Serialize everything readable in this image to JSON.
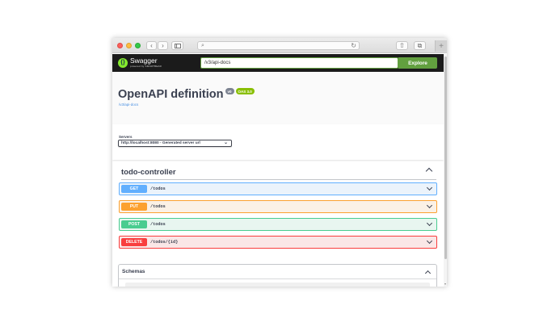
{
  "browser": {
    "address": "",
    "new_tab": "+"
  },
  "swagger": {
    "logo_name": "Swagger",
    "logo_sub": "powered by SMARTBEAR",
    "spec_url": "/v3/api-docs",
    "explore_label": "Explore"
  },
  "info": {
    "title": "OpenAPI definition",
    "version_badge": "v0",
    "oas_badge": "OAS 3.0",
    "spec_link": "/v3/api-docs"
  },
  "servers": {
    "label": "Servers",
    "selected": "http://localhost:8080 - Generated server url"
  },
  "tag": {
    "name": "todo-controller"
  },
  "operations": [
    {
      "method": "GET",
      "path": "/todos"
    },
    {
      "method": "PUT",
      "path": "/todos"
    },
    {
      "method": "POST",
      "path": "/todos"
    },
    {
      "method": "DELETE",
      "path": "/todos/{id}"
    }
  ],
  "schemas": {
    "title": "Schemas"
  },
  "colors": {
    "get": "#61affe",
    "put": "#fca130",
    "post": "#49cc90",
    "delete": "#f93e3e",
    "swagger_green": "#62a03f",
    "header_bg": "#1b1b1b"
  }
}
